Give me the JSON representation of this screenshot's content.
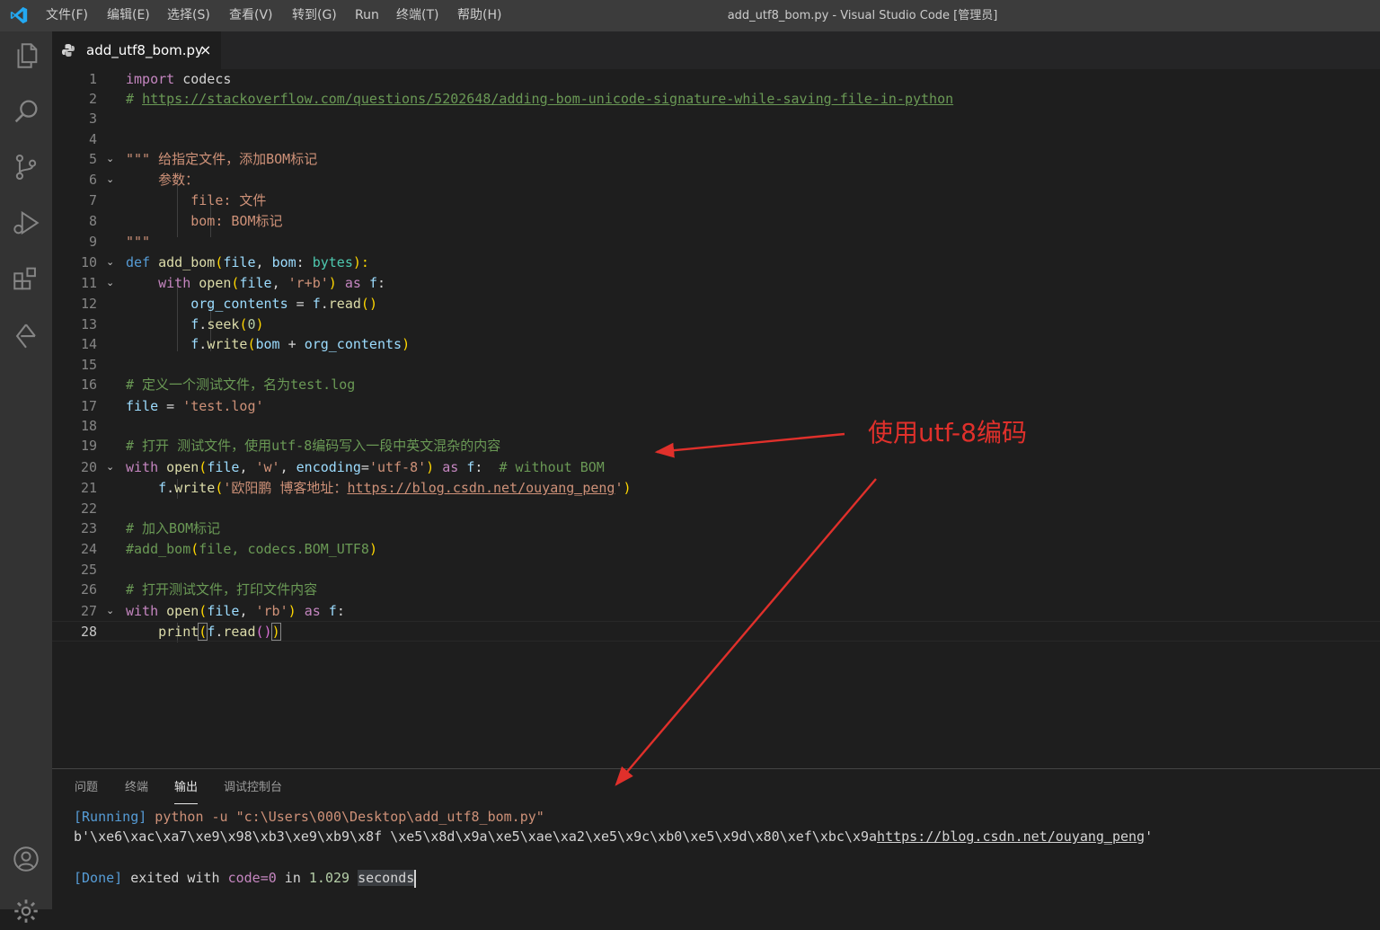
{
  "titlebar": {
    "menu": [
      "文件(F)",
      "编辑(E)",
      "选择(S)",
      "查看(V)",
      "转到(G)",
      "Run",
      "终端(T)",
      "帮助(H)"
    ],
    "window_title": "add_utf8_bom.py - Visual Studio Code [管理员]"
  },
  "activity_bar": {
    "icons": [
      "files-icon",
      "search-icon",
      "source-control-icon",
      "run-debug-icon",
      "extensions-icon",
      "remote-explorer-icon",
      "account-icon",
      "settings-gear-icon"
    ]
  },
  "tab": {
    "label": "add_utf8_bom.py",
    "close": "×",
    "icon": "python-file-icon"
  },
  "editor": {
    "current_line": 28,
    "lines": [
      {
        "n": "1"
      },
      {
        "n": "2"
      },
      {
        "n": "3"
      },
      {
        "n": "4"
      },
      {
        "n": "5"
      },
      {
        "n": "6"
      },
      {
        "n": "7"
      },
      {
        "n": "8"
      },
      {
        "n": "9"
      },
      {
        "n": "10"
      },
      {
        "n": "11"
      },
      {
        "n": "12"
      },
      {
        "n": "13"
      },
      {
        "n": "14"
      },
      {
        "n": "15"
      },
      {
        "n": "16"
      },
      {
        "n": "17"
      },
      {
        "n": "18"
      },
      {
        "n": "19"
      },
      {
        "n": "20"
      },
      {
        "n": "21"
      },
      {
        "n": "22"
      },
      {
        "n": "23"
      },
      {
        "n": "24"
      },
      {
        "n": "25"
      },
      {
        "n": "26"
      },
      {
        "n": "27"
      },
      {
        "n": "28"
      }
    ],
    "tokens": {
      "l1": [
        "import",
        " codecs"
      ],
      "l2": [
        "# ",
        "https://stackoverflow.com/questions/5202648/adding-bom-unicode-signature-while-saving-file-in-python"
      ],
      "l5": "\"\"\" 给指定文件，添加BOM标记",
      "l6": "    参数：",
      "l7": "        file: 文件",
      "l8": "        bom: BOM标记",
      "l9": "\"\"\"",
      "l10": [
        "def",
        " ",
        "add_bom",
        "(",
        "file",
        ", ",
        "bom",
        ": ",
        "bytes",
        "):"
      ],
      "l11": [
        "    ",
        "with",
        " ",
        "open",
        "(",
        "file",
        ", ",
        "'r+b'",
        ")",
        " ",
        "as",
        " ",
        "f",
        ":"
      ],
      "l12": [
        "        ",
        "org_contents",
        " = ",
        "f",
        ".",
        "read",
        "(",
        ")"
      ],
      "l13": [
        "        ",
        "f",
        ".",
        "seek",
        "(",
        "0",
        ")"
      ],
      "l14": [
        "        ",
        "f",
        ".",
        "write",
        "(",
        "bom",
        " + ",
        "org_contents",
        ")"
      ],
      "l16": "# 定义一个测试文件，名为test.log",
      "l17": [
        "file",
        " = ",
        "'test.log'"
      ],
      "l19": "# 打开 测试文件，使用utf-8编码写入一段中英文混杂的内容",
      "l20": [
        "with",
        " ",
        "open",
        "(",
        "file",
        ", ",
        "'w'",
        ", ",
        "encoding",
        "=",
        "'utf-8'",
        ")",
        " ",
        "as",
        " ",
        "f",
        ":  ",
        "# without BOM"
      ],
      "l21": [
        "    ",
        "f",
        ".",
        "write",
        "(",
        "'欧阳鹏 博客地址：",
        "https://blog.csdn.net/ouyang_peng",
        "'",
        ")"
      ],
      "l23": "# 加入BOM标记",
      "l24": [
        "#add_bom",
        "(",
        "file, codecs.BOM_UTF8",
        ")"
      ],
      "l26": "# 打开测试文件，打印文件内容",
      "l27": [
        "with",
        " ",
        "open",
        "(",
        "file",
        ", ",
        "'rb'",
        ")",
        " ",
        "as",
        " ",
        "f",
        ":"
      ],
      "l28": [
        "    ",
        "print",
        "(",
        "f",
        ".",
        "read",
        "(",
        ")",
        ")"
      ]
    }
  },
  "panel": {
    "tabs": [
      "问题",
      "终端",
      "输出",
      "调试控制台"
    ],
    "active_tab": "输出",
    "output": {
      "running_tag": "[Running]",
      "running_cmd": " python -u \"c:\\Users\\000\\Desktop\\add_utf8_bom.py\"",
      "bytes_prefix": "b'\\xe6\\xac\\xa7\\xe9\\x98\\xb3\\xe9\\xb9\\x8f \\xe5\\x8d\\x9a\\xe5\\xae\\xa2\\xe5\\x9c\\xb0\\xe5\\x9d\\x80\\xef\\xbc\\x9a",
      "bytes_link": "https://blog.csdn.net/ouyang_peng",
      "bytes_suffix": "'",
      "done_tag": "[Done]",
      "done_exited": " exited with ",
      "done_code": "code=0",
      "done_in": " in ",
      "done_time": "1.029",
      "done_seconds": "seconds"
    }
  },
  "annotation": {
    "text": "使用utf-8编码",
    "color": "#e0302b"
  }
}
